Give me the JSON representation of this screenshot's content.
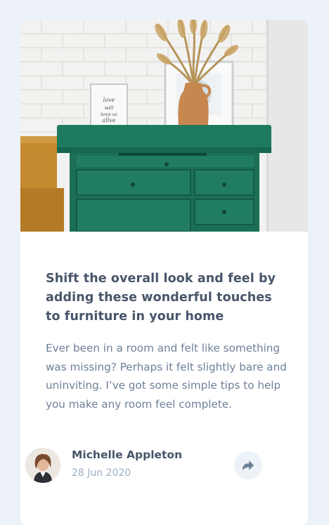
{
  "article": {
    "image_alt": "Green painted dresser with vase of dried grass and framed prints against white brick wall",
    "title": "Shift the overall look and feel by adding these wonderful touches to furniture in your home",
    "description": "Ever been in a room and felt like something was missing? Perhaps it felt slightly bare and uninviting. I’ve got some simple tips to help you make any room feel complete."
  },
  "author": {
    "name": "Michelle Appleton",
    "date": "28 Jun 2020",
    "avatar_icon": "avatar-photo"
  },
  "share": {
    "icon": "share-icon",
    "aria_label": "Share"
  },
  "colors": {
    "background": "#ecf2f8",
    "card": "#ffffff",
    "title": "#48556a",
    "text": "#6e8098",
    "muted": "#9eafc2",
    "share_bg": "#ecf2f8",
    "share_icon": "#6e8098"
  }
}
